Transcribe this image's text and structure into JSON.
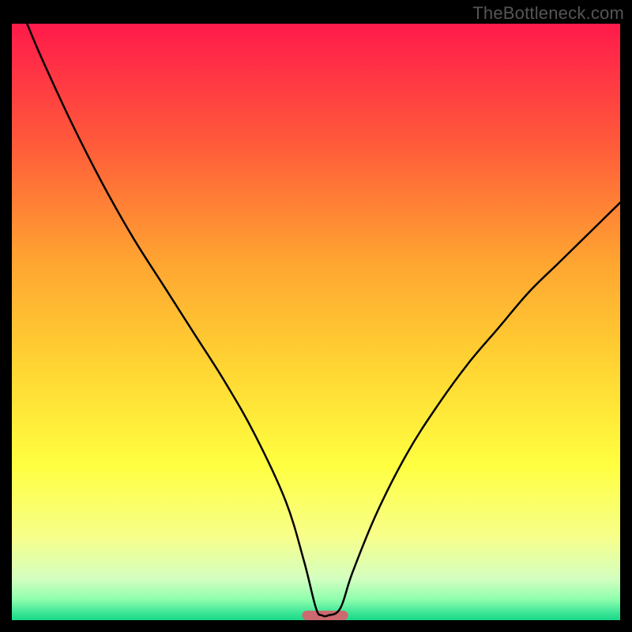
{
  "watermark": "TheBottleneck.com",
  "chart_data": {
    "type": "line",
    "title": "",
    "xlabel": "",
    "ylabel": "",
    "xlim": [
      0,
      100
    ],
    "ylim": [
      0,
      100
    ],
    "grid": false,
    "legend": false,
    "background_gradient_stops": [
      {
        "offset": 0.0,
        "color": "#ff1a4b"
      },
      {
        "offset": 0.2,
        "color": "#ff5a3a"
      },
      {
        "offset": 0.4,
        "color": "#ffa531"
      },
      {
        "offset": 0.58,
        "color": "#ffd633"
      },
      {
        "offset": 0.74,
        "color": "#ffff40"
      },
      {
        "offset": 0.86,
        "color": "#f7ff8a"
      },
      {
        "offset": 0.93,
        "color": "#d4ffc0"
      },
      {
        "offset": 0.965,
        "color": "#8fffae"
      },
      {
        "offset": 0.985,
        "color": "#46e89a"
      },
      {
        "offset": 1.0,
        "color": "#18d887"
      }
    ],
    "series": [
      {
        "name": "bottleneck-curve",
        "stroke": "#000000",
        "stroke_width": 2.5,
        "x": [
          2.5,
          5,
          10,
          15,
          20,
          25,
          30,
          35,
          40,
          45,
          48,
          50,
          51,
          52,
          54,
          56,
          60,
          65,
          70,
          75,
          80,
          85,
          90,
          95,
          100
        ],
        "y": [
          100,
          94,
          83,
          73,
          64,
          56,
          48,
          40,
          31,
          20,
          10,
          2,
          0.8,
          0.8,
          2,
          8,
          18,
          28,
          36,
          43,
          49,
          55,
          60,
          65,
          70
        ]
      }
    ],
    "annotations": [
      {
        "name": "target-marker",
        "shape": "hline-rounded",
        "x_center": 51.5,
        "y": 0.8,
        "width": 6,
        "stroke": "#cc6a6f",
        "stroke_width": 12
      }
    ]
  }
}
